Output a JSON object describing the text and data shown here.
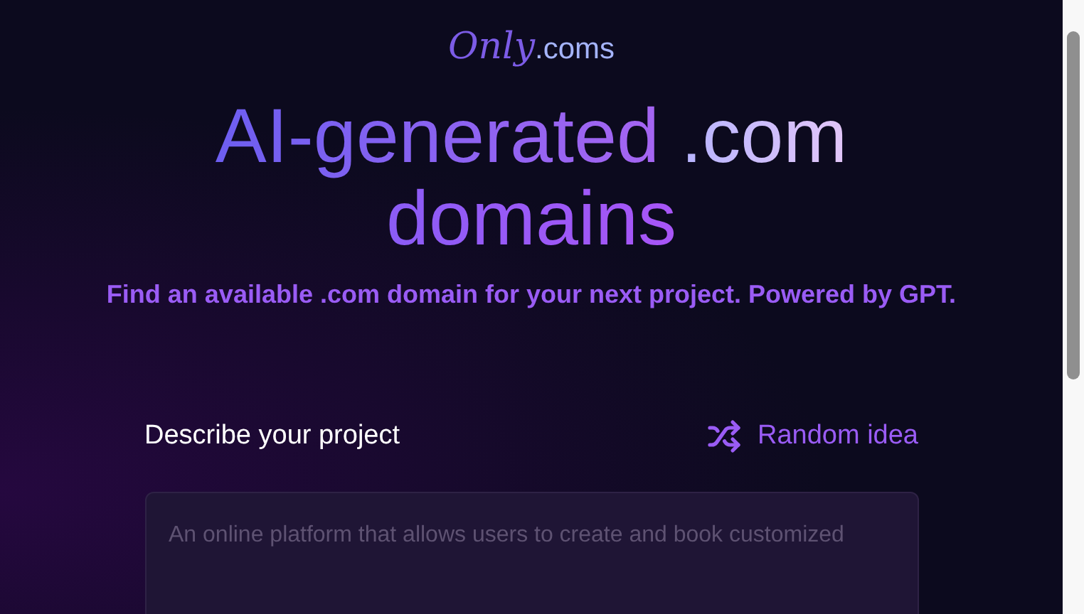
{
  "logo": {
    "script": "Only",
    "suffix": ".coms"
  },
  "headline": {
    "gradient_part": "AI-generated",
    "light_part": ".com",
    "second_line": "domains"
  },
  "subtitle": "Find an available .com domain for your next project. Powered by GPT.",
  "form": {
    "label": "Describe your project",
    "random_button": "Random idea",
    "placeholder": "An online platform that allows users to create and book customized"
  }
}
